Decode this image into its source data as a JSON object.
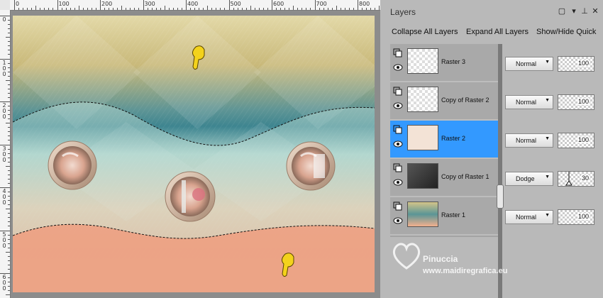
{
  "rulers": {
    "horizontal": [
      "0",
      "100",
      "200",
      "300",
      "400",
      "500",
      "600",
      "700",
      "800"
    ],
    "vertical": [
      "0",
      "100",
      "200",
      "300",
      "400",
      "500",
      "600"
    ]
  },
  "layers_panel": {
    "title": "Layers",
    "toolbar": {
      "collapse_all": "Collapse All Layers",
      "expand_all": "Expand All Layers",
      "show_hide_quick": "Show/Hide Quick"
    },
    "layers": [
      {
        "name": "Raster 3",
        "blend_mode": "Normal",
        "opacity": "100",
        "opacity_level": 1.0,
        "selected": false
      },
      {
        "name": "Copy of Raster 2",
        "blend_mode": "Normal",
        "opacity": "100",
        "opacity_level": 1.0,
        "selected": false
      },
      {
        "name": "Raster 2",
        "blend_mode": "Normal",
        "opacity": "100",
        "opacity_level": 1.0,
        "selected": true
      },
      {
        "name": "Copy of Raster 1",
        "blend_mode": "Dodge",
        "opacity": "30",
        "opacity_level": 0.3,
        "selected": false
      },
      {
        "name": "Raster 1",
        "blend_mode": "Normal",
        "opacity": "100",
        "opacity_level": 1.0,
        "selected": false
      }
    ]
  },
  "watermark": {
    "name": "Pinuccia",
    "url": "www.maidiregrafica.eu"
  },
  "colors": {
    "panel_bg": "#b9b9b9",
    "selected_layer": "#3399ff",
    "image_top": "#d9c98a",
    "image_teal": "#4f8f95",
    "image_peach": "#f3b48e",
    "image_bottom": "#ec9c7a"
  }
}
